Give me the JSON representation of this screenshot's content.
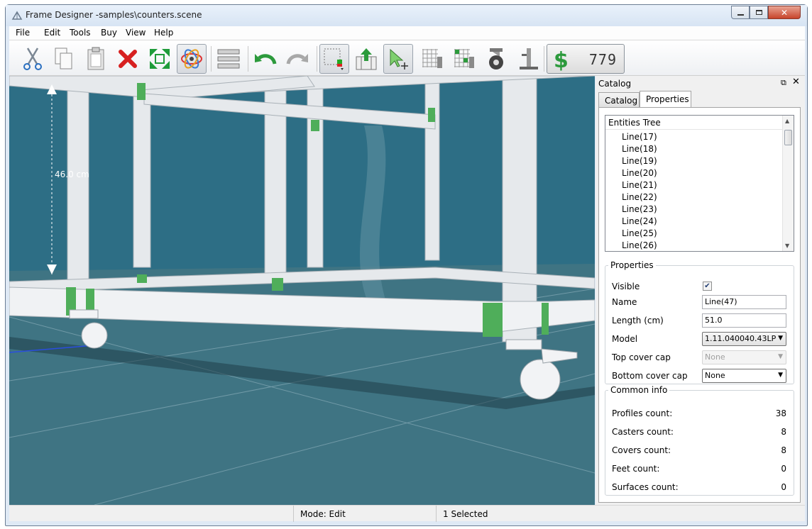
{
  "window": {
    "title": "Frame Designer -samples\\counters.scene",
    "min_icon": "minimize-icon",
    "max_icon": "maximize-icon",
    "close_icon": "close-icon"
  },
  "menu": [
    "File",
    "Edit",
    "Tools",
    "Buy",
    "View",
    "Help"
  ],
  "toolbar": {
    "icons": [
      "cut-icon",
      "copy-icon",
      "paste-icon",
      "delete-icon",
      "fit-view-icon",
      "orbit-icon",
      "align-icon",
      "undo-icon",
      "redo-icon",
      "grid-icon",
      "export-icon",
      "select-icon",
      "grid-add-icon",
      "grid-remove-icon",
      "caster-icon",
      "profile-cap-icon",
      "dollar-icon"
    ],
    "money": "779"
  },
  "viewport": {
    "dimension_label": "46.0 cm"
  },
  "panel": {
    "title": "Catalog",
    "tabs": [
      "Catalog",
      "Properties"
    ],
    "tree": {
      "header": "Entities Tree",
      "items": [
        "Line(17)",
        "Line(18)",
        "Line(19)",
        "Line(20)",
        "Line(21)",
        "Line(22)",
        "Line(23)",
        "Line(24)",
        "Line(25)",
        "Line(26)"
      ]
    },
    "properties": {
      "legend": "Properties",
      "visible_label": "Visible",
      "name_label": "Name",
      "name_value": "Line(47)",
      "length_label": "Length (cm)",
      "length_value": "51.0",
      "model_label": "Model",
      "model_value": "1.11.040040.43LP",
      "top_cap_label": "Top cover cap",
      "top_cap_value": "None",
      "bottom_cap_label": "Bottom cover cap",
      "bottom_cap_value": "None"
    },
    "info": {
      "legend": "Common info",
      "rows": [
        {
          "label": "Profiles count:",
          "value": "38"
        },
        {
          "label": "Casters count:",
          "value": "8"
        },
        {
          "label": "Covers count:",
          "value": "8"
        },
        {
          "label": "Feet count:",
          "value": "0"
        },
        {
          "label": "Surfaces count:",
          "value": "0"
        }
      ]
    }
  },
  "status": {
    "mode": "Mode: Edit",
    "selected": "1 Selected"
  }
}
